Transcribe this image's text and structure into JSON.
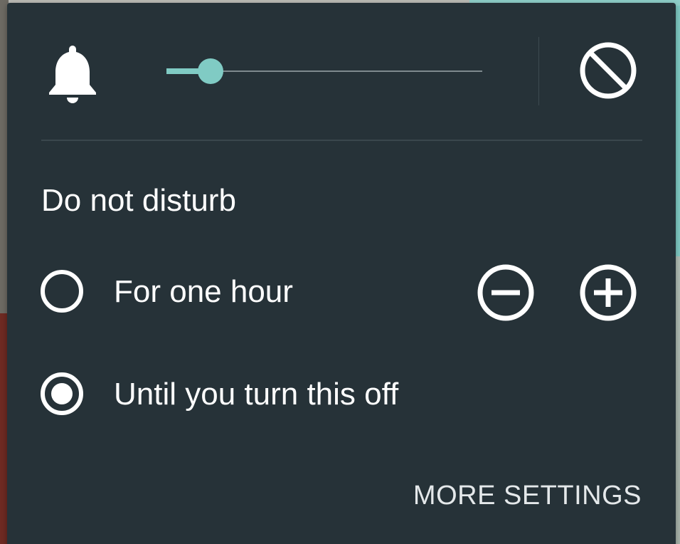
{
  "volume": {
    "bell_icon": "bell-icon",
    "level_fraction": 0.14,
    "mute_icon": "do-not-disturb-icon"
  },
  "dnd": {
    "title": "Do not disturb",
    "options": [
      {
        "label": "For one hour",
        "selected": false
      },
      {
        "label": "Until you turn this off",
        "selected": true
      }
    ],
    "decrease_icon": "minus-circle-icon",
    "increase_icon": "plus-circle-icon",
    "more_settings_label": "MORE SETTINGS"
  },
  "colors": {
    "panel_bg": "#263238",
    "accent": "#80cbc4",
    "text": "#ffffff"
  }
}
